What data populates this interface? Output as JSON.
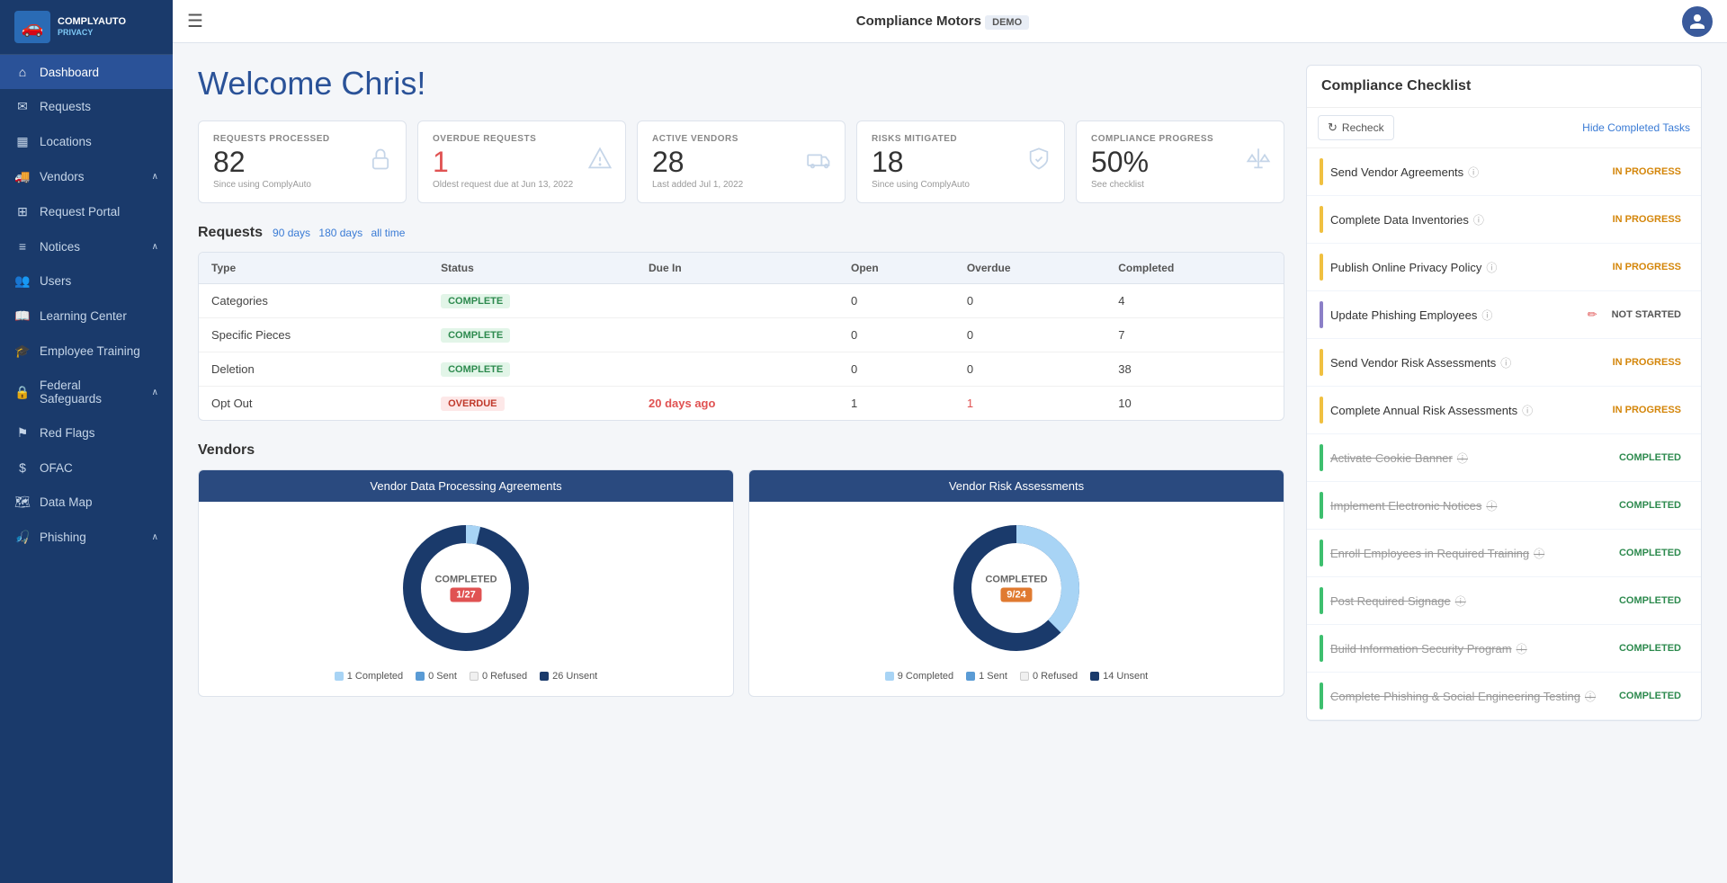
{
  "app": {
    "company": "Compliance Motors",
    "demo_label": "DEMO",
    "welcome": "Welcome Chris!"
  },
  "topbar": {
    "menu_icon": "☰",
    "avatar_icon": "👤"
  },
  "sidebar": {
    "items": [
      {
        "id": "dashboard",
        "label": "Dashboard",
        "icon": "⌂",
        "active": true
      },
      {
        "id": "requests",
        "label": "Requests",
        "icon": "✉"
      },
      {
        "id": "locations",
        "label": "Locations",
        "icon": "▦"
      },
      {
        "id": "vendors",
        "label": "Vendors",
        "icon": "🚚",
        "arrow": "∧"
      },
      {
        "id": "request-portal",
        "label": "Request Portal",
        "icon": "⊞"
      },
      {
        "id": "notices",
        "label": "Notices",
        "icon": "≡",
        "arrow": "∧"
      },
      {
        "id": "users",
        "label": "Users",
        "icon": "👥"
      },
      {
        "id": "learning-center",
        "label": "Learning Center",
        "icon": "📖"
      },
      {
        "id": "employee-training",
        "label": "Employee Training",
        "icon": "🎓"
      },
      {
        "id": "federal-safeguards",
        "label": "Federal Safeguards",
        "icon": "🔒",
        "arrow": "∧"
      },
      {
        "id": "red-flags",
        "label": "Red Flags",
        "icon": "⚑"
      },
      {
        "id": "ofac",
        "label": "OFAC",
        "icon": "$"
      },
      {
        "id": "data-map",
        "label": "Data Map",
        "icon": "🗺"
      },
      {
        "id": "phishing",
        "label": "Phishing",
        "icon": "🎣",
        "arrow": "∧"
      }
    ]
  },
  "stats": [
    {
      "id": "requests-processed",
      "label": "REQUESTS PROCESSED",
      "value": "82",
      "sub": "Since using ComplyAuto",
      "icon": "🔒",
      "overdue": false
    },
    {
      "id": "overdue-requests",
      "label": "OVERDUE REQUESTS",
      "value": "1",
      "sub": "Oldest request due at Jun 13, 2022",
      "icon": "⚠",
      "overdue": true
    },
    {
      "id": "active-vendors",
      "label": "ACTIVE VENDORS",
      "value": "28",
      "sub": "Last added Jul 1, 2022",
      "icon": "🚚",
      "overdue": false
    },
    {
      "id": "risks-mitigated",
      "label": "RISKS MITIGATED",
      "value": "18",
      "sub": "Since using ComplyAuto",
      "icon": "🛡",
      "overdue": false
    },
    {
      "id": "compliance-progress",
      "label": "COMPLIANCE PROGRESS",
      "value": "50%",
      "sub": "See checklist",
      "icon": "⚖",
      "overdue": false
    }
  ],
  "requests": {
    "section_label": "Requests",
    "filters": [
      "90 days",
      "180 days",
      "all time"
    ],
    "columns": [
      "Type",
      "Status",
      "Due In",
      "Open",
      "Overdue",
      "Completed"
    ],
    "rows": [
      {
        "type": "Categories",
        "status": "COMPLETE",
        "status_type": "complete",
        "due_in": "",
        "open": "0",
        "overdue": "0",
        "completed": "4"
      },
      {
        "type": "Specific Pieces",
        "status": "COMPLETE",
        "status_type": "complete",
        "due_in": "",
        "open": "0",
        "overdue": "0",
        "completed": "7"
      },
      {
        "type": "Deletion",
        "status": "COMPLETE",
        "status_type": "complete",
        "due_in": "",
        "open": "0",
        "overdue": "0",
        "completed": "38"
      },
      {
        "type": "Opt Out",
        "status": "OVERDUE",
        "status_type": "overdue",
        "due_in": "20 days ago",
        "open": "1",
        "overdue": "1",
        "completed": "10"
      }
    ]
  },
  "vendors": {
    "section_label": "Vendors",
    "charts": [
      {
        "id": "dpa",
        "title": "Vendor Data Processing Agreements",
        "completed_label": "COMPLETED",
        "badge": "1/27",
        "badge_color": "red",
        "completed_val": 1,
        "total": 27,
        "legend": [
          {
            "label": "1 Completed",
            "dot": "light-blue"
          },
          {
            "label": "0 Sent",
            "dot": "mid-blue"
          },
          {
            "label": "0 Refused",
            "dot": "refused"
          },
          {
            "label": "26 Unsent",
            "dot": "dark-blue"
          }
        ]
      },
      {
        "id": "vra",
        "title": "Vendor Risk Assessments",
        "completed_label": "COMPLETED",
        "badge": "9/24",
        "badge_color": "orange",
        "completed_val": 9,
        "total": 24,
        "legend": [
          {
            "label": "9 Completed",
            "dot": "light-blue"
          },
          {
            "label": "1 Sent",
            "dot": "mid-blue"
          },
          {
            "label": "0 Refused",
            "dot": "refused"
          },
          {
            "label": "14 Unsent",
            "dot": "dark-blue"
          }
        ]
      }
    ]
  },
  "checklist": {
    "title": "Compliance Checklist",
    "recheck_label": "Recheck",
    "hide_label": "Hide Completed Tasks",
    "items": [
      {
        "label": "Send Vendor Agreements",
        "status": "IN PROGRESS",
        "status_type": "in-progress",
        "bar": "yellow",
        "completed": false
      },
      {
        "label": "Complete Data Inventories",
        "status": "IN PROGRESS",
        "status_type": "in-progress",
        "bar": "yellow",
        "completed": false
      },
      {
        "label": "Publish Online Privacy Policy",
        "status": "IN PROGRESS",
        "status_type": "in-progress",
        "bar": "yellow",
        "completed": false
      },
      {
        "label": "Update Phishing Employees",
        "status": "NOT STARTED",
        "status_type": "not-started",
        "bar": "purple",
        "completed": false,
        "has_pencil": true
      },
      {
        "label": "Send Vendor Risk Assessments",
        "status": "IN PROGRESS",
        "status_type": "in-progress",
        "bar": "yellow",
        "completed": false
      },
      {
        "label": "Complete Annual Risk Assessments",
        "status": "IN PROGRESS",
        "status_type": "in-progress",
        "bar": "yellow",
        "completed": false
      },
      {
        "label": "Activate Cookie Banner",
        "status": "COMPLETED",
        "status_type": "completed",
        "bar": "green",
        "completed": true
      },
      {
        "label": "Implement Electronic Notices",
        "status": "COMPLETED",
        "status_type": "completed",
        "bar": "green",
        "completed": true
      },
      {
        "label": "Enroll Employees in Required Training",
        "status": "COMPLETED",
        "status_type": "completed",
        "bar": "green",
        "completed": true
      },
      {
        "label": "Post Required Signage",
        "status": "COMPLETED",
        "status_type": "completed",
        "bar": "green",
        "completed": true
      },
      {
        "label": "Build Information Security Program",
        "status": "COMPLETED",
        "status_type": "completed",
        "bar": "green",
        "completed": true
      },
      {
        "label": "Complete Phishing & Social Engineering Testing",
        "status": "COMPLETED",
        "status_type": "completed",
        "bar": "green",
        "completed": true
      }
    ]
  }
}
